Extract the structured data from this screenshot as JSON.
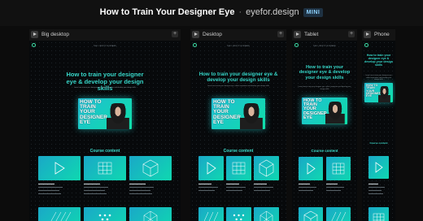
{
  "header": {
    "title": "How to Train Your Designer Eye",
    "separator": "·",
    "domain": "eyefor.design",
    "badge": "MINI"
  },
  "panels": [
    {
      "label": "Big desktop"
    },
    {
      "label": "Desktop"
    },
    {
      "label": "Tablet"
    },
    {
      "label": "Phone"
    }
  ],
  "page": {
    "nav": "THE LIFESTYLE BRAND",
    "hero_title": "How to train your designer eye & develop your design skills",
    "hero_subtitle": "Learn how to train your designer eye, collect inspiration and develop your design skills",
    "cover_title": "HOW TO TRAIN YOUR DESIGNER EYE",
    "section_title": "Course content",
    "icons": {
      "logo": "ring-logo-icon",
      "play": "play-icon",
      "add": "add-icon"
    }
  },
  "colors": {
    "accent": "#36d6c8",
    "card_gradient_start": "#1aa8c8",
    "card_gradient_end": "#0fd8b0",
    "badge": "#8ed3ff"
  }
}
